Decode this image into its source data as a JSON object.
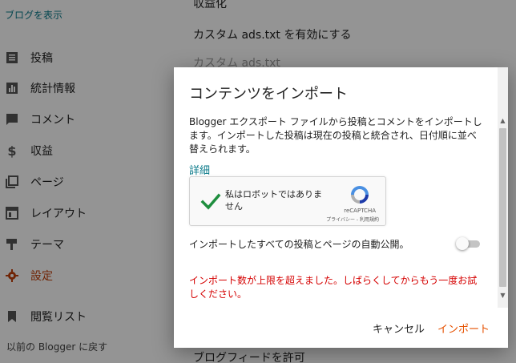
{
  "sidebar": {
    "view_blog": "ブログを表示",
    "items": [
      {
        "label": "投稿",
        "icon": "posts-icon"
      },
      {
        "label": "統計情報",
        "icon": "stats-icon"
      },
      {
        "label": "コメント",
        "icon": "comment-icon"
      },
      {
        "label": "収益",
        "icon": "dollar-icon"
      },
      {
        "label": "ページ",
        "icon": "pages-icon"
      },
      {
        "label": "レイアウト",
        "icon": "layout-icon"
      },
      {
        "label": "テーマ",
        "icon": "theme-icon"
      },
      {
        "label": "設定",
        "icon": "gear-icon",
        "active": true
      },
      {
        "label": "閲覧リスト",
        "icon": "bookmark-icon"
      }
    ],
    "footer": "以前の Blogger に戻す",
    "active_color": "#c2410c"
  },
  "background": {
    "item_top": "収益化",
    "ads_txt_enable": "カスタム ads.txt を有効にする",
    "ads_txt": "カスタム ads.txt",
    "blog_feed": "ブログフィードを許可"
  },
  "dialog": {
    "title": "コンテンツをインポート",
    "description": "Blogger エクスポート ファイルから投稿とコメントをインポートします。インポートした投稿は現在の投稿と統合され、日付順に並べ替えられます。",
    "details_link": "詳細",
    "recaptcha": {
      "label": "私はロボットではありません",
      "brand": "reCAPTCHA",
      "privacy": "プライバシー - 利用規約",
      "checked": true
    },
    "autopublish_label": "インポートしたすべての投稿とページの自動公開。",
    "autopublish_enabled": false,
    "error": "インポート数が上限を超えました。しばらくしてからもう一度お試しください。",
    "cancel_button": "キャンセル",
    "import_button": "インポート",
    "link_color": "#0a7a8a",
    "error_color": "#d50000",
    "accent_color": "#e65100"
  }
}
